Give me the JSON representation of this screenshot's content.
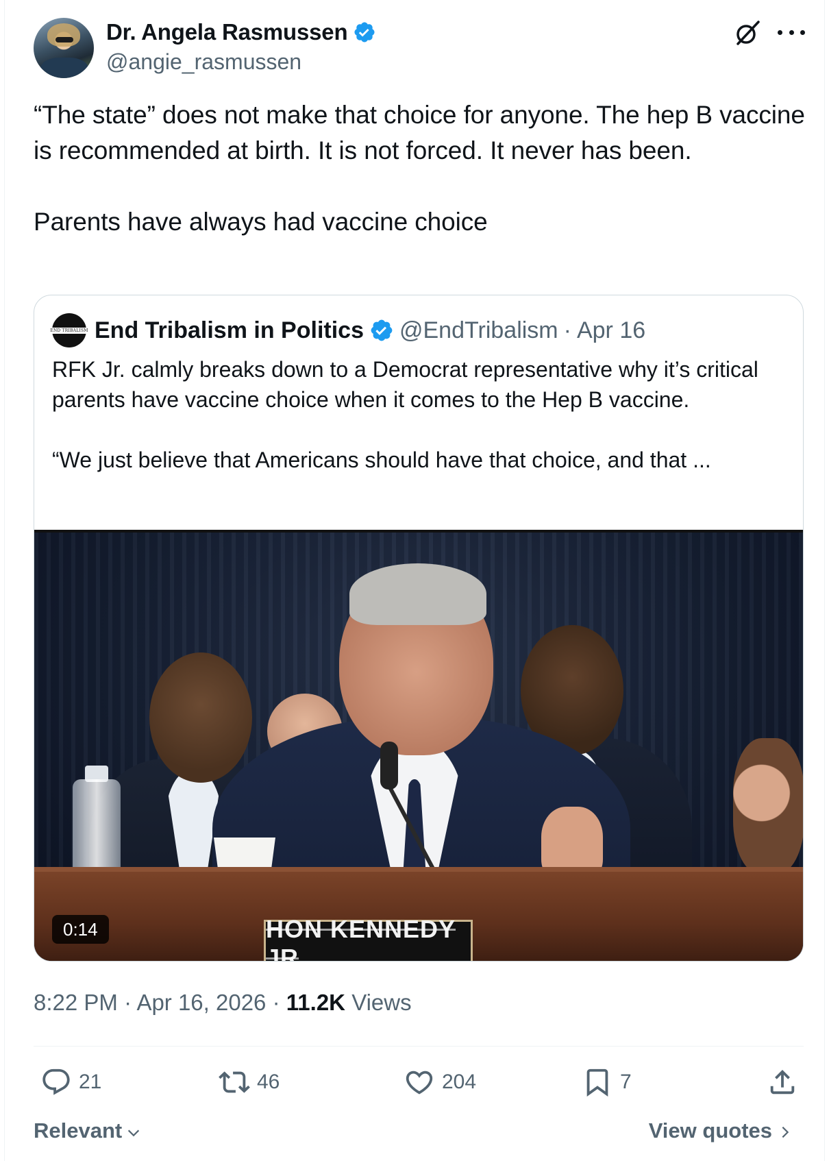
{
  "author": {
    "display_name": "Dr. Angela Rasmussen",
    "handle": "@angie_rasmussen",
    "verified": true
  },
  "tweet": {
    "text": "“The state” does not make that choice for anyone. The hep B vaccine is recommended at birth. It is not forced. It never has been.\n\nParents have always had vaccine choice"
  },
  "quote": {
    "avatar_text": "END TRIBALISM",
    "display_name": "End Tribalism in Politics",
    "handle": "@EndTribalism",
    "separator": "·",
    "date": "Apr 16",
    "text": "RFK Jr. calmly breaks down to a Democrat representative why it’s critical parents have vaccine choice when it comes to the Hep B vaccine.\n\n“We just believe that Americans should have that choice, and that ...",
    "video": {
      "duration": "0:14",
      "nameplate": "HON KENNEDY JR"
    }
  },
  "meta": {
    "time": "8:22 PM",
    "separator": "·",
    "date": "Apr 16, 2026",
    "views_count": "11.2K",
    "views_label": "Views"
  },
  "actions": {
    "replies": "21",
    "reposts": "46",
    "likes": "204",
    "bookmarks": "7"
  },
  "footer": {
    "sort_label": "Relevant",
    "view_quotes_label": "View quotes"
  },
  "colors": {
    "verified_blue": "#1d9bf0",
    "secondary_text": "#536471",
    "primary_text": "#0f1419",
    "border": "#cfd9de"
  },
  "icons": [
    "grok-icon",
    "more-icon",
    "verified-badge-icon",
    "reply-icon",
    "repost-icon",
    "like-icon",
    "bookmark-icon",
    "share-icon",
    "chevron-down-icon",
    "chevron-right-icon"
  ]
}
